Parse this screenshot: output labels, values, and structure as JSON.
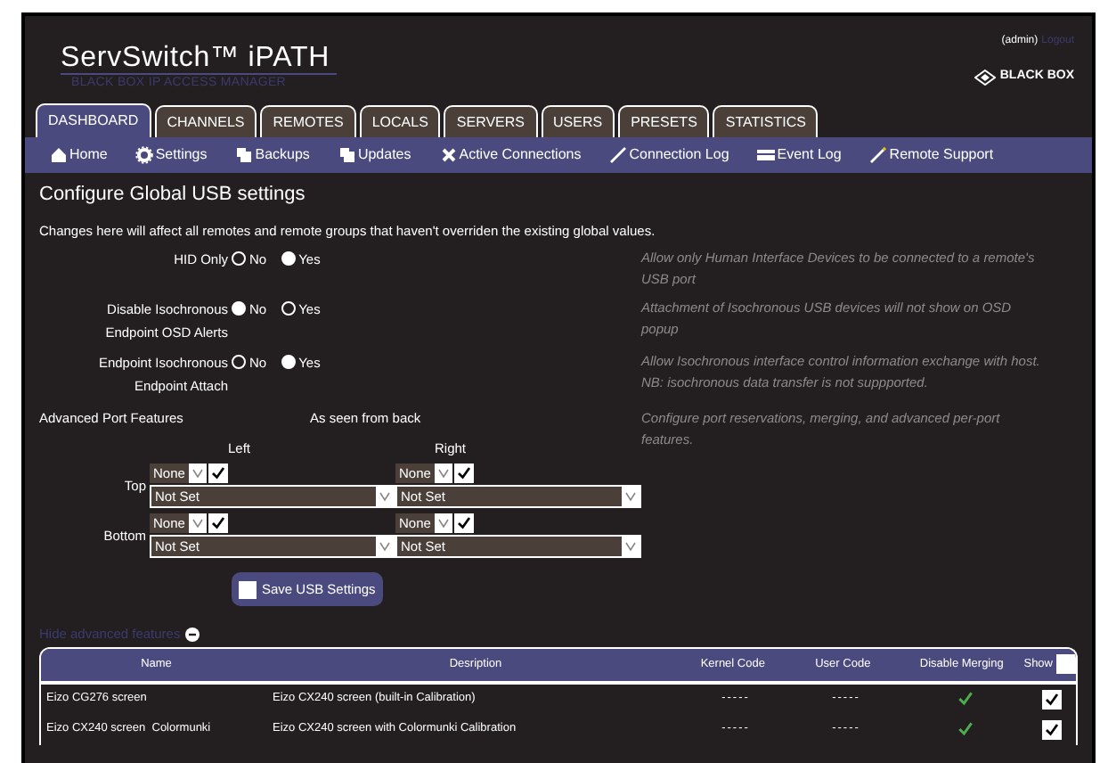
{
  "header": {
    "product": "ServSwitch™ iPATH",
    "subtitle": "BLACK BOX IP ACCESS MANAGER",
    "user": "(admin)",
    "logout": "Logout",
    "brand": "BLACK BOX"
  },
  "tabs": [
    {
      "label": "DASHBOARD",
      "selected": true
    },
    {
      "label": "CHANNELS",
      "selected": false
    },
    {
      "label": "REMOTES",
      "selected": false
    },
    {
      "label": "LOCALS",
      "selected": false
    },
    {
      "label": "SERVERS",
      "selected": false
    },
    {
      "label": "USERS",
      "selected": false
    },
    {
      "label": "PRESETS",
      "selected": false
    },
    {
      "label": "STATISTICS",
      "selected": false
    }
  ],
  "nav": [
    {
      "label": "Home",
      "kind": "home"
    },
    {
      "label": "Settings",
      "kind": "gear"
    },
    {
      "label": "Backups",
      "kind": "copy"
    },
    {
      "label": "Updates",
      "kind": "copy"
    },
    {
      "label": "Active Connections",
      "kind": "cross"
    },
    {
      "label": "Connection Log",
      "kind": "pen"
    },
    {
      "label": "Event Log",
      "kind": "card"
    },
    {
      "label": "Remote Support",
      "kind": "pencil"
    }
  ],
  "heading": "Configure Global USB settings",
  "intro": "Changes here will affect all remotes and remote groups that haven't overriden the existing global values.",
  "options": [
    {
      "label": [
        "HID Only"
      ],
      "choices": [
        {
          "label": "No",
          "selected": false
        },
        {
          "label": "Yes",
          "selected": true
        }
      ],
      "help": "Allow only Human Interface Devices to be connected to a remote's USB port"
    },
    {
      "label": [
        "Disable Isochronous",
        "Endpoint OSD Alerts"
      ],
      "choices": [
        {
          "label": "No",
          "selected": true
        },
        {
          "label": "Yes",
          "selected": false
        }
      ],
      "help": "Attachment of Isochronous USB devices will not show on OSD popup"
    },
    {
      "label": [
        "Endpoint Isochronous",
        "Endpoint Attach"
      ],
      "choices": [
        {
          "label": "No",
          "selected": false
        },
        {
          "label": "Yes",
          "selected": true
        }
      ],
      "help": "Allow Isochronous interface control information exchange with host. NB: isochronous data transfer is not suppported."
    }
  ],
  "ports": {
    "label": "Advanced Port Features",
    "orientation": "As seen from back",
    "help": "Configure port reservations, merging, and advanced per-port features.",
    "columns": [
      "Left",
      "Right"
    ],
    "rows": [
      {
        "label": "Top",
        "cells": [
          {
            "reservation": "None",
            "checked": true,
            "mode": "Not Set"
          },
          {
            "reservation": "None",
            "checked": true,
            "mode": "Not Set"
          }
        ]
      },
      {
        "label": "Bottom",
        "cells": [
          {
            "reservation": "None",
            "checked": true,
            "mode": "Not Set"
          },
          {
            "reservation": "None",
            "checked": true,
            "mode": "Not Set"
          }
        ]
      }
    ]
  },
  "save_button": "Save USB Settings",
  "toggle_link": "Hide advanced features",
  "table": {
    "columns": [
      "Name",
      "Desription",
      "Kernel Code",
      "User Code",
      "Disable Merging",
      "Show"
    ],
    "show_all": false,
    "rows": [
      {
        "name": "Eizo CG276 screen",
        "description": "Eizo CX240 screen (built-in Calibration)",
        "kernel_code": "-----",
        "user_code": "-----",
        "disable_merging": true,
        "show": true
      },
      {
        "name": "Eizo CX240 screen  Colormunki",
        "description": "Eizo CX240 screen with Colormunki Calibration",
        "kernel_code": "-----",
        "user_code": "-----",
        "disable_merging": true,
        "show": true
      }
    ]
  }
}
